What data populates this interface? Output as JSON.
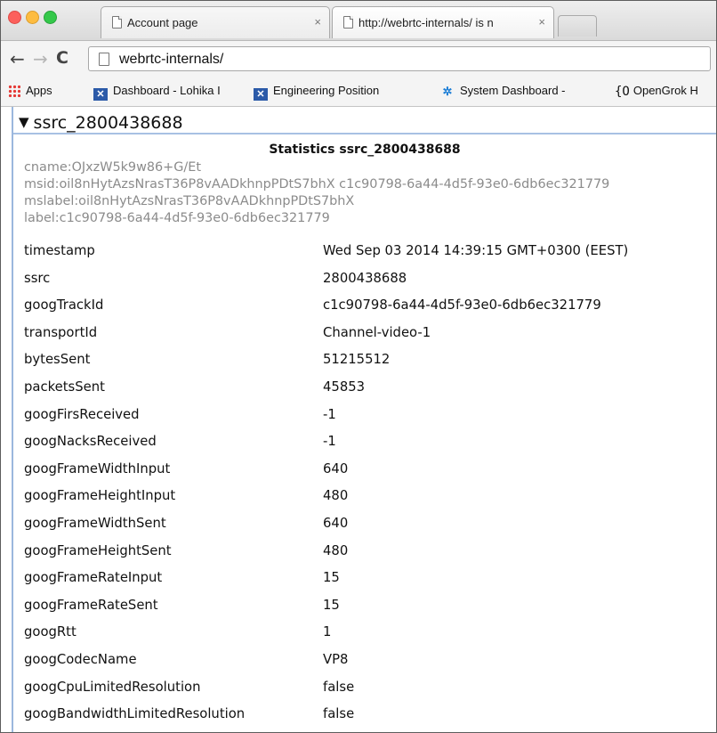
{
  "browser": {
    "tabs": [
      {
        "title": "Account page",
        "close": "×"
      },
      {
        "title": "http://webrtc-internals/ is n",
        "close": "×"
      }
    ],
    "nav": {
      "back": "←",
      "forward": "→",
      "reload": "C"
    },
    "address": "webrtc-internals/",
    "bookmarks": [
      {
        "label": "Apps",
        "icon": "apps-grid-icon"
      },
      {
        "label": "Dashboard - Lohika I",
        "icon": "lohika-icon"
      },
      {
        "label": "Engineering Position",
        "icon": "lohika-icon"
      },
      {
        "label": "System Dashboard -",
        "icon": "system-dashboard-icon"
      },
      {
        "label": "OpenGrok H",
        "icon": "opengrok-icon"
      }
    ]
  },
  "page": {
    "section_toggle": "▼",
    "section_title": "ssrc_2800438688",
    "stats_title": "Statistics ssrc_2800438688",
    "meta": [
      "cname:OJxzW5k9w86+G/Et",
      "msid:oil8nHytAzsNrasT36P8vAADkhnpPDtS7bhX c1c90798-6a44-4d5f-93e0-6db6ec321779",
      "mslabel:oil8nHytAzsNrasT36P8vAADkhnpPDtS7bhX",
      "label:c1c90798-6a44-4d5f-93e0-6db6ec321779"
    ],
    "stats": [
      {
        "key": "timestamp",
        "value": "Wed Sep 03 2014 14:39:15 GMT+0300 (EEST)"
      },
      {
        "key": "ssrc",
        "value": "2800438688"
      },
      {
        "key": "googTrackId",
        "value": "c1c90798-6a44-4d5f-93e0-6db6ec321779"
      },
      {
        "key": "transportId",
        "value": "Channel-video-1"
      },
      {
        "key": "bytesSent",
        "value": "51215512"
      },
      {
        "key": "packetsSent",
        "value": "45853"
      },
      {
        "key": "googFirsReceived",
        "value": "-1"
      },
      {
        "key": "googNacksReceived",
        "value": "-1"
      },
      {
        "key": "googFrameWidthInput",
        "value": "640"
      },
      {
        "key": "googFrameHeightInput",
        "value": "480"
      },
      {
        "key": "googFrameWidthSent",
        "value": "640"
      },
      {
        "key": "googFrameHeightSent",
        "value": "480"
      },
      {
        "key": "googFrameRateInput",
        "value": "15"
      },
      {
        "key": "googFrameRateSent",
        "value": "15"
      },
      {
        "key": "googRtt",
        "value": "1"
      },
      {
        "key": "googCodecName",
        "value": "VP8"
      },
      {
        "key": "googCpuLimitedResolution",
        "value": "false"
      },
      {
        "key": "googBandwidthLimitedResolution",
        "value": "false"
      }
    ]
  }
}
